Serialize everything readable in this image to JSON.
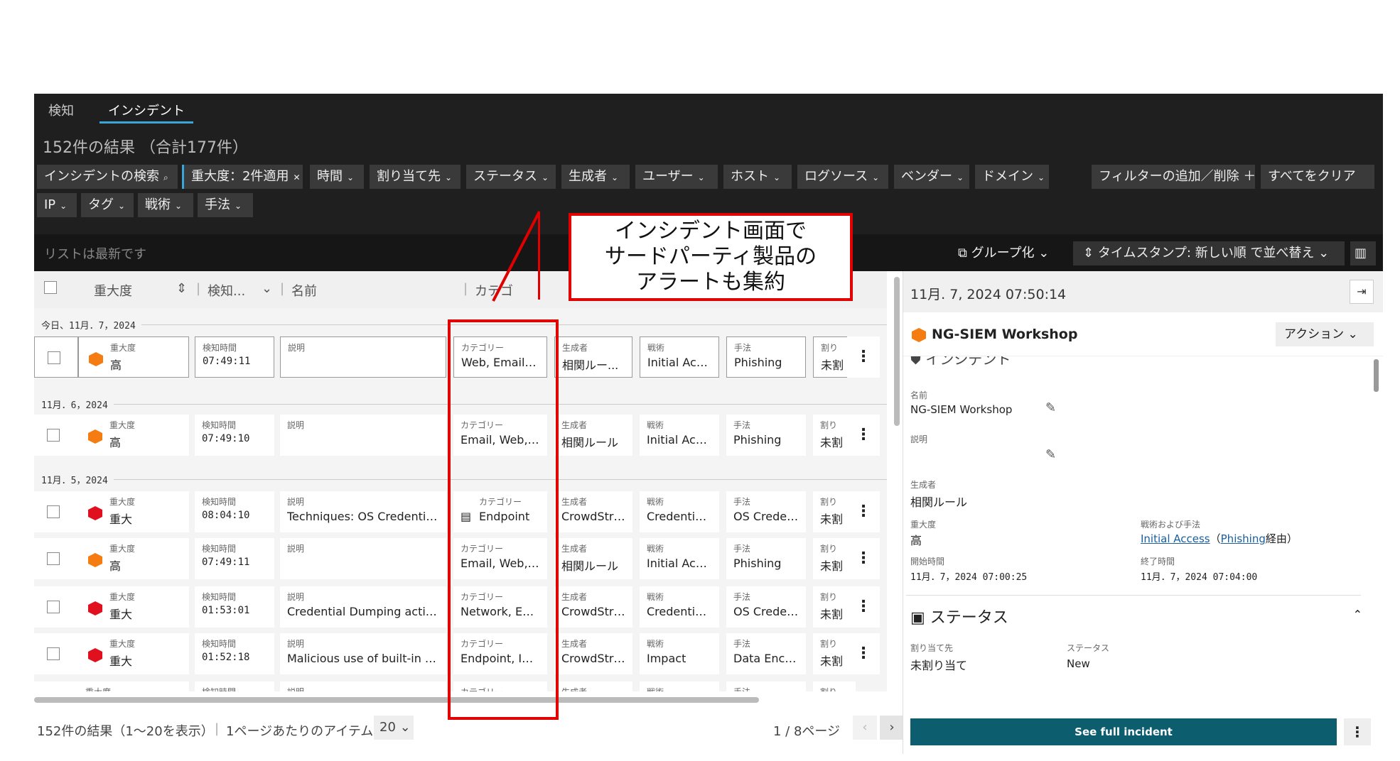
{
  "tabs": [
    {
      "label": "検知"
    },
    {
      "label": "インシデント"
    }
  ],
  "results_summary": "152件の結果 （合計177件）",
  "filters": {
    "search": "インシデントの検索",
    "severity": "重大度：2件適用",
    "chips": [
      "時間",
      "割り当て先",
      "ステータス",
      "生成者",
      "ユーザー",
      "ホスト",
      "ログソース",
      "ベンダー",
      "ドメイン"
    ],
    "chips2": [
      "IP",
      "タグ",
      "戦術",
      "手法"
    ],
    "add_remove": "フィルターの追加／削除 ＋",
    "clear_all": "すべてをクリア"
  },
  "subbar": {
    "fresh": "リストは最新です",
    "group": "グループ化",
    "sort": "タイムスタンプ: 新しい順 で並べ替え"
  },
  "table": {
    "headers": {
      "severity": "重大度",
      "detected": "検知...",
      "name": "名前",
      "category": "カテゴ"
    },
    "labels": {
      "severity": "重大度",
      "detected": "検知時間",
      "desc": "説明",
      "category": "カテゴリー",
      "creator": "生成者",
      "tactic": "戦術",
      "technique": "手法",
      "assign": "割り",
      "assign_val": "未割"
    },
    "groups": [
      {
        "date": "今日、11月．7，2024"
      },
      {
        "date": "11月．6，2024"
      },
      {
        "date": "11月．5，2024"
      }
    ],
    "rows": [
      {
        "severity": "高",
        "color": "#f47c10",
        "time": "07:49:11",
        "desc": "",
        "category": "Web, Email, N...",
        "creator": "相関ルー...",
        "tactic": "Initial Acc...",
        "technique": "Phishing"
      },
      {
        "severity": "高",
        "color": "#f47c10",
        "time": "07:49:10",
        "desc": "",
        "category": "Email, Web, N...",
        "creator": "相関ルール",
        "tactic": "Initial Acce...",
        "technique": "Phishing"
      },
      {
        "severity": "重大",
        "color": "#e0101e",
        "time": "08:04:10",
        "desc": "Techniques: OS Credential ...",
        "category": "Endpoint",
        "creator": "CrowdStrike",
        "tactic": "Credential ...",
        "technique": "OS Creden..."
      },
      {
        "severity": "高",
        "color": "#f47c10",
        "time": "07:49:11",
        "desc": "",
        "category": "Email, Web, N...",
        "creator": "相関ルール",
        "tactic": "Initial Acce...",
        "technique": "Phishing"
      },
      {
        "severity": "重大",
        "color": "#e0101e",
        "time": "01:53:01",
        "desc": "Credential Dumping activity...",
        "category": "Network, End...",
        "creator": "CrowdStrike",
        "tactic": "Credential ...",
        "technique": "OS Creden..."
      },
      {
        "severity": "重大",
        "color": "#e0101e",
        "time": "01:52:18",
        "desc": "Malicious use of built-in tool...",
        "category": "Endpoint, Ide...",
        "creator": "CrowdStrike",
        "tactic": "Impact",
        "technique": "Data Encry..."
      }
    ]
  },
  "footer": {
    "summary": "152件の結果（1〜20を表示）",
    "per_page": "1ページあたりのアイテム",
    "per_page_val": "20",
    "page": "1 / 8ページ"
  },
  "panel": {
    "timestamp": "11月. 7, 2024 07:50:14",
    "title": "NG-SIEM Workshop",
    "action": "アクション",
    "section_incident": "インシデント",
    "name_label": "名前",
    "name_val": "NG-SIEM Workshop",
    "desc_label": "説明",
    "creator_label": "生成者",
    "creator_val": "相関ルール",
    "severity_label": "重大度",
    "severity_val": "高",
    "tactic_label": "戦術および手法",
    "tactic_link": "Initial Access",
    "tactic_mid": "（",
    "technique_link": "Phishing",
    "tactic_end": "経由）",
    "start_label": "開始時間",
    "start_val": "11月．7，2024 07:00:25",
    "end_label": "終了時間",
    "end_val": "11月．7，2024 07:04:00",
    "section_status": "ステータス",
    "assignee_label": "割り当て先",
    "assignee_val": "未割り当て",
    "status_label": "ステータス",
    "status_val": "New",
    "see_full": "See full incident"
  },
  "callout": {
    "line1": "インシデント画面で",
    "line2": "サードパーティ製品の",
    "line3": "アラートも集約"
  },
  "colors": {
    "accent": "#3aa6d8",
    "critical": "#e0101e",
    "high": "#f47c10",
    "primary_btn": "#0c5d6e",
    "annotation": "#e00000"
  }
}
